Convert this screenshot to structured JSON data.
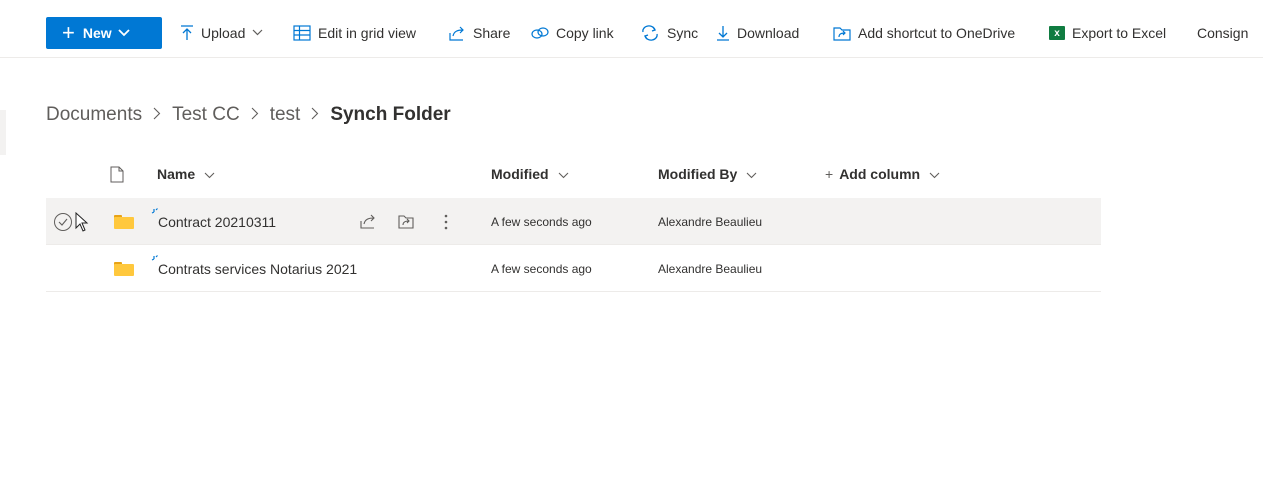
{
  "commandbar": {
    "new_label": "New",
    "upload_label": "Upload",
    "grid_label": "Edit in grid view",
    "share_label": "Share",
    "copylink_label": "Copy link",
    "sync_label": "Sync",
    "download_label": "Download",
    "shortcut_label": "Add shortcut to OneDrive",
    "export_label": "Export to Excel",
    "consign_label": "Consign"
  },
  "breadcrumb": {
    "items": [
      "Documents",
      "Test CC",
      "test"
    ],
    "current": "Synch Folder"
  },
  "list": {
    "columns": {
      "name": "Name",
      "modified": "Modified",
      "modified_by": "Modified By",
      "add_column": "Add column"
    },
    "rows": [
      {
        "name": "Contract 20210311",
        "modified": "A few seconds ago",
        "modified_by": "Alexandre Beaulieu"
      },
      {
        "name": "Contrats services Notarius 2021",
        "modified": "A few seconds ago",
        "modified_by": "Alexandre Beaulieu"
      }
    ]
  },
  "colors": {
    "accent": "#0078d4",
    "folder": "#ffc83d",
    "excel": "#107c41",
    "row_hover": "#f3f2f1"
  },
  "icons": [
    "plus-icon",
    "upload-icon",
    "grid-icon",
    "share-icon",
    "link-icon",
    "sync-icon",
    "download-icon",
    "shortcut-icon",
    "excel-icon",
    "file-type-icon",
    "folder-icon",
    "check-circle-icon",
    "more-icon"
  ]
}
